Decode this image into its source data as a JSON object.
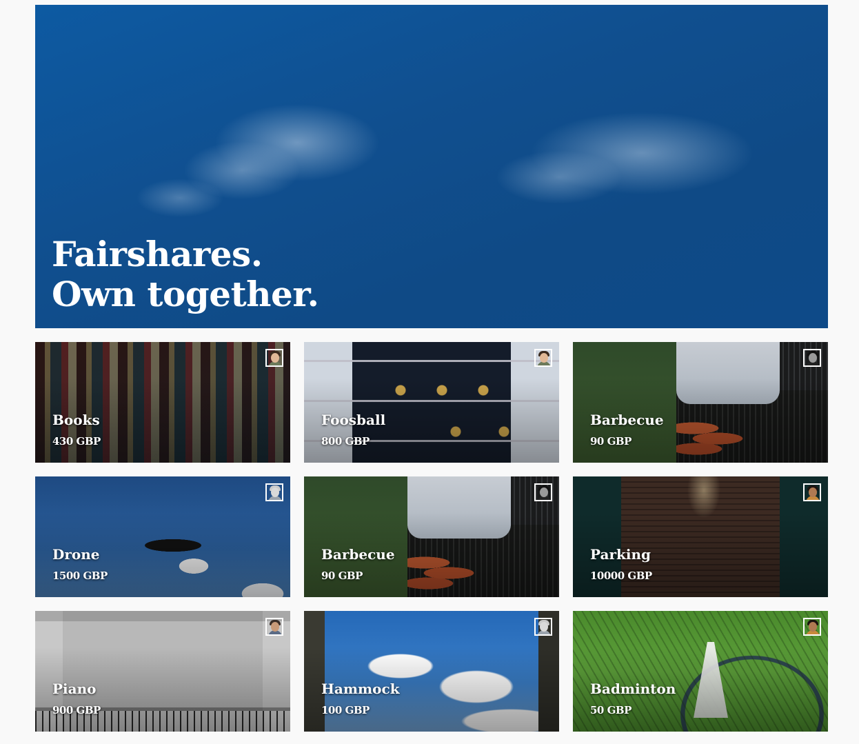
{
  "hero": {
    "line1": "Fairshares.",
    "line2": "Own together."
  },
  "items": [
    {
      "name": "Books",
      "price": "430 GBP",
      "avatar_icon": "user-avatar-icon"
    },
    {
      "name": "Foosball",
      "price": "800 GBP",
      "avatar_icon": "user-avatar-icon"
    },
    {
      "name": "Barbecue",
      "price": "90 GBP",
      "avatar_icon": "user-avatar-icon"
    },
    {
      "name": "Drone",
      "price": "1500 GBP",
      "avatar_icon": "user-avatar-icon"
    },
    {
      "name": "Barbecue",
      "price": "90 GBP",
      "avatar_icon": "user-avatar-icon"
    },
    {
      "name": "Parking",
      "price": "10000 GBP",
      "avatar_icon": "user-avatar-icon"
    },
    {
      "name": "Piano",
      "price": "900 GBP",
      "avatar_icon": "user-avatar-icon"
    },
    {
      "name": "Hammock",
      "price": "100 GBP",
      "avatar_icon": "user-avatar-icon"
    },
    {
      "name": "Badminton",
      "price": "50 GBP",
      "avatar_icon": "user-avatar-icon"
    }
  ],
  "colors": {
    "page_background": "#f9f9f9",
    "hero_blue": "#0f4e8c",
    "text": "#ffffff"
  }
}
